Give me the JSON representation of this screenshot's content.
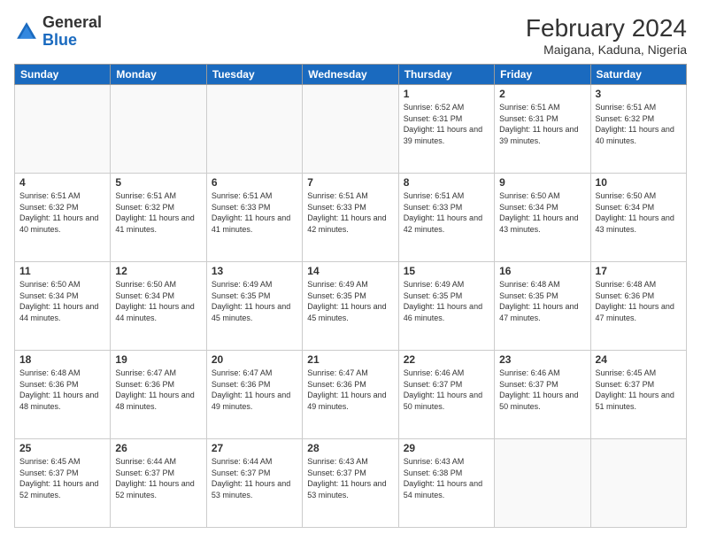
{
  "header": {
    "logo_general": "General",
    "logo_blue": "Blue",
    "month_year": "February 2024",
    "location": "Maigana, Kaduna, Nigeria"
  },
  "columns": [
    "Sunday",
    "Monday",
    "Tuesday",
    "Wednesday",
    "Thursday",
    "Friday",
    "Saturday"
  ],
  "weeks": [
    [
      {
        "day": "",
        "info": ""
      },
      {
        "day": "",
        "info": ""
      },
      {
        "day": "",
        "info": ""
      },
      {
        "day": "",
        "info": ""
      },
      {
        "day": "1",
        "info": "Sunrise: 6:52 AM\nSunset: 6:31 PM\nDaylight: 11 hours and 39 minutes."
      },
      {
        "day": "2",
        "info": "Sunrise: 6:51 AM\nSunset: 6:31 PM\nDaylight: 11 hours and 39 minutes."
      },
      {
        "day": "3",
        "info": "Sunrise: 6:51 AM\nSunset: 6:32 PM\nDaylight: 11 hours and 40 minutes."
      }
    ],
    [
      {
        "day": "4",
        "info": "Sunrise: 6:51 AM\nSunset: 6:32 PM\nDaylight: 11 hours and 40 minutes."
      },
      {
        "day": "5",
        "info": "Sunrise: 6:51 AM\nSunset: 6:32 PM\nDaylight: 11 hours and 41 minutes."
      },
      {
        "day": "6",
        "info": "Sunrise: 6:51 AM\nSunset: 6:33 PM\nDaylight: 11 hours and 41 minutes."
      },
      {
        "day": "7",
        "info": "Sunrise: 6:51 AM\nSunset: 6:33 PM\nDaylight: 11 hours and 42 minutes."
      },
      {
        "day": "8",
        "info": "Sunrise: 6:51 AM\nSunset: 6:33 PM\nDaylight: 11 hours and 42 minutes."
      },
      {
        "day": "9",
        "info": "Sunrise: 6:50 AM\nSunset: 6:34 PM\nDaylight: 11 hours and 43 minutes."
      },
      {
        "day": "10",
        "info": "Sunrise: 6:50 AM\nSunset: 6:34 PM\nDaylight: 11 hours and 43 minutes."
      }
    ],
    [
      {
        "day": "11",
        "info": "Sunrise: 6:50 AM\nSunset: 6:34 PM\nDaylight: 11 hours and 44 minutes."
      },
      {
        "day": "12",
        "info": "Sunrise: 6:50 AM\nSunset: 6:34 PM\nDaylight: 11 hours and 44 minutes."
      },
      {
        "day": "13",
        "info": "Sunrise: 6:49 AM\nSunset: 6:35 PM\nDaylight: 11 hours and 45 minutes."
      },
      {
        "day": "14",
        "info": "Sunrise: 6:49 AM\nSunset: 6:35 PM\nDaylight: 11 hours and 45 minutes."
      },
      {
        "day": "15",
        "info": "Sunrise: 6:49 AM\nSunset: 6:35 PM\nDaylight: 11 hours and 46 minutes."
      },
      {
        "day": "16",
        "info": "Sunrise: 6:48 AM\nSunset: 6:35 PM\nDaylight: 11 hours and 47 minutes."
      },
      {
        "day": "17",
        "info": "Sunrise: 6:48 AM\nSunset: 6:36 PM\nDaylight: 11 hours and 47 minutes."
      }
    ],
    [
      {
        "day": "18",
        "info": "Sunrise: 6:48 AM\nSunset: 6:36 PM\nDaylight: 11 hours and 48 minutes."
      },
      {
        "day": "19",
        "info": "Sunrise: 6:47 AM\nSunset: 6:36 PM\nDaylight: 11 hours and 48 minutes."
      },
      {
        "day": "20",
        "info": "Sunrise: 6:47 AM\nSunset: 6:36 PM\nDaylight: 11 hours and 49 minutes."
      },
      {
        "day": "21",
        "info": "Sunrise: 6:47 AM\nSunset: 6:36 PM\nDaylight: 11 hours and 49 minutes."
      },
      {
        "day": "22",
        "info": "Sunrise: 6:46 AM\nSunset: 6:37 PM\nDaylight: 11 hours and 50 minutes."
      },
      {
        "day": "23",
        "info": "Sunrise: 6:46 AM\nSunset: 6:37 PM\nDaylight: 11 hours and 50 minutes."
      },
      {
        "day": "24",
        "info": "Sunrise: 6:45 AM\nSunset: 6:37 PM\nDaylight: 11 hours and 51 minutes."
      }
    ],
    [
      {
        "day": "25",
        "info": "Sunrise: 6:45 AM\nSunset: 6:37 PM\nDaylight: 11 hours and 52 minutes."
      },
      {
        "day": "26",
        "info": "Sunrise: 6:44 AM\nSunset: 6:37 PM\nDaylight: 11 hours and 52 minutes."
      },
      {
        "day": "27",
        "info": "Sunrise: 6:44 AM\nSunset: 6:37 PM\nDaylight: 11 hours and 53 minutes."
      },
      {
        "day": "28",
        "info": "Sunrise: 6:43 AM\nSunset: 6:37 PM\nDaylight: 11 hours and 53 minutes."
      },
      {
        "day": "29",
        "info": "Sunrise: 6:43 AM\nSunset: 6:38 PM\nDaylight: 11 hours and 54 minutes."
      },
      {
        "day": "",
        "info": ""
      },
      {
        "day": "",
        "info": ""
      }
    ]
  ]
}
